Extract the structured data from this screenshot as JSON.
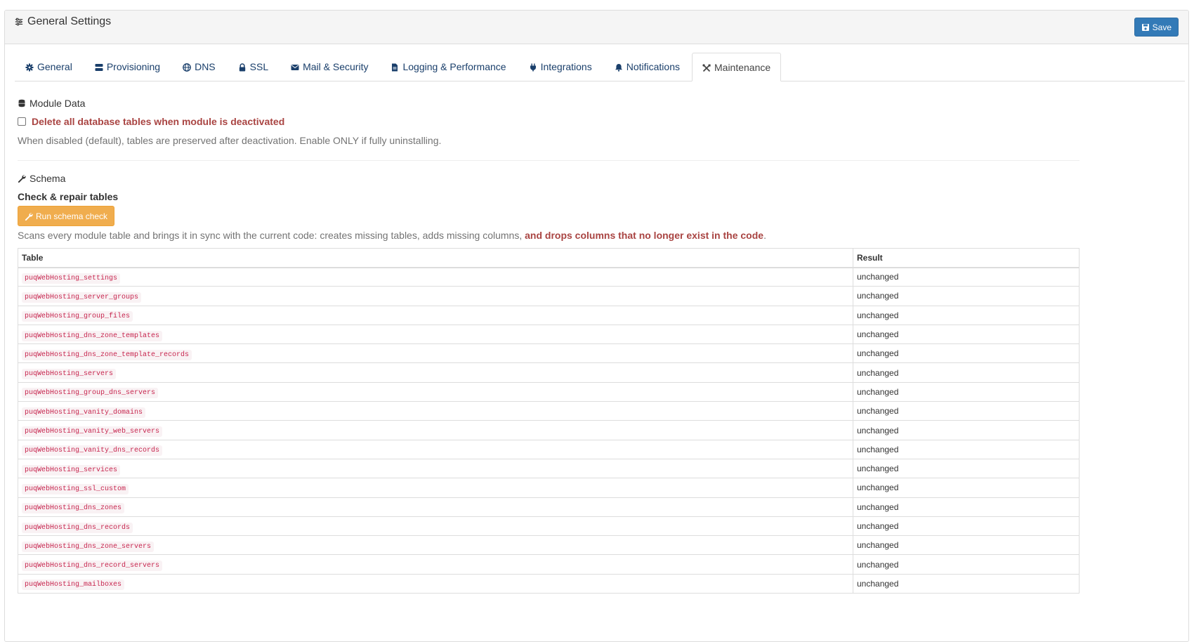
{
  "header": {
    "title": "General Settings",
    "save_label": "Save"
  },
  "tabs": [
    {
      "label": "General",
      "icon": "gear-icon"
    },
    {
      "label": "Provisioning",
      "icon": "server-icon"
    },
    {
      "label": "DNS",
      "icon": "globe-icon"
    },
    {
      "label": "SSL",
      "icon": "lock-icon"
    },
    {
      "label": "Mail & Security",
      "icon": "envelope-icon"
    },
    {
      "label": "Logging & Performance",
      "icon": "file-icon"
    },
    {
      "label": "Integrations",
      "icon": "plug-icon"
    },
    {
      "label": "Notifications",
      "icon": "bell-icon"
    },
    {
      "label": "Maintenance",
      "icon": "tools-icon",
      "active": true
    }
  ],
  "module_data": {
    "title": "Module Data",
    "checkbox_label": "Delete all database tables when module is deactivated",
    "checked": false,
    "help": "When disabled (default), tables are preserved after deactivation. Enable ONLY if fully uninstalling."
  },
  "schema": {
    "title": "Schema",
    "subtitle": "Check & repair tables",
    "run_button": "Run schema check",
    "description_prefix": "Scans every module table and brings it in sync with the current code: creates missing tables, adds missing columns, ",
    "description_warning": "and drops columns that no longer exist in the code",
    "description_suffix": ".",
    "table_header": "Table",
    "result_header": "Result",
    "rows": [
      {
        "table": "puqWebHosting_settings",
        "result": "unchanged"
      },
      {
        "table": "puqWebHosting_server_groups",
        "result": "unchanged"
      },
      {
        "table": "puqWebHosting_group_files",
        "result": "unchanged"
      },
      {
        "table": "puqWebHosting_dns_zone_templates",
        "result": "unchanged"
      },
      {
        "table": "puqWebHosting_dns_zone_template_records",
        "result": "unchanged"
      },
      {
        "table": "puqWebHosting_servers",
        "result": "unchanged"
      },
      {
        "table": "puqWebHosting_group_dns_servers",
        "result": "unchanged"
      },
      {
        "table": "puqWebHosting_vanity_domains",
        "result": "unchanged"
      },
      {
        "table": "puqWebHosting_vanity_web_servers",
        "result": "unchanged"
      },
      {
        "table": "puqWebHosting_vanity_dns_records",
        "result": "unchanged"
      },
      {
        "table": "puqWebHosting_services",
        "result": "unchanged"
      },
      {
        "table": "puqWebHosting_ssl_custom",
        "result": "unchanged"
      },
      {
        "table": "puqWebHosting_dns_zones",
        "result": "unchanged"
      },
      {
        "table": "puqWebHosting_dns_records",
        "result": "unchanged"
      },
      {
        "table": "puqWebHosting_dns_zone_servers",
        "result": "unchanged"
      },
      {
        "table": "puqWebHosting_dns_record_servers",
        "result": "unchanged"
      },
      {
        "table": "puqWebHosting_mailboxes",
        "result": "unchanged"
      }
    ]
  }
}
